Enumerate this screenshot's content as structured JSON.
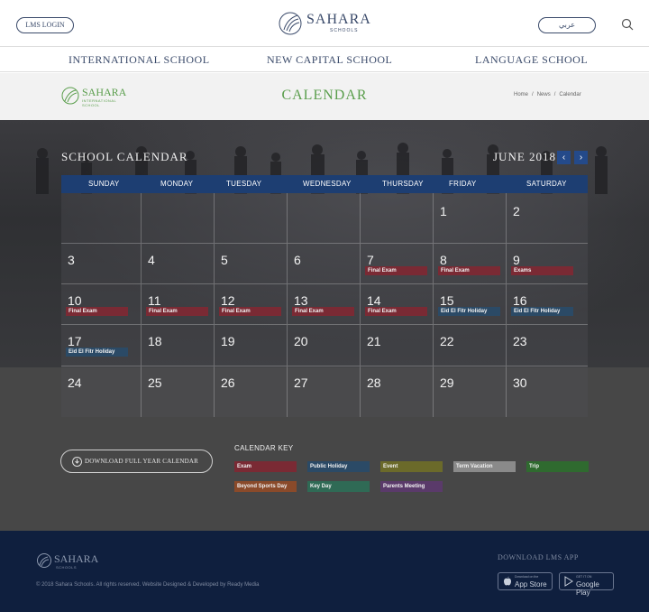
{
  "header": {
    "lms_login": "LMS LOGIN",
    "arabic_label": "عربي",
    "logo_word": "SAHARA",
    "logo_sub": "SCHOOLS"
  },
  "nav": {
    "items": [
      "INTERNATIONAL SCHOOL",
      "NEW CAPITAL SCHOOL",
      "LANGUAGE SCHOOL"
    ]
  },
  "title_band": {
    "title": "CALENDAR",
    "small_logo_word": "SAHARA",
    "small_logo_sub": "INTERNATIONAL SCHOOL",
    "breadcrumb": [
      "Home",
      "News",
      "Calendar"
    ],
    "separator": "/"
  },
  "calendar": {
    "heading": "SCHOOL CALENDAR",
    "month": "JUNE 2018",
    "prev_icon": "chevron-left-icon",
    "next_icon": "chevron-right-icon",
    "weekdays": [
      "SUNDAY",
      "MONDAY",
      "TUESDAY",
      "WEDNESDAY",
      "THURSDAY",
      "FRIDAY",
      "SATURDAY"
    ],
    "weeks": [
      [
        {
          "d": ""
        },
        {
          "d": ""
        },
        {
          "d": ""
        },
        {
          "d": ""
        },
        {
          "d": ""
        },
        {
          "d": "1"
        },
        {
          "d": "2"
        }
      ],
      [
        {
          "d": "3"
        },
        {
          "d": "4"
        },
        {
          "d": "5"
        },
        {
          "d": "6"
        },
        {
          "d": "7",
          "ev": "Final Exam",
          "t": "exam"
        },
        {
          "d": "8",
          "ev": "Final Exam",
          "t": "exam"
        },
        {
          "d": "9",
          "ev": "Exams",
          "t": "exam"
        }
      ],
      [
        {
          "d": "10",
          "ev": "Final Exam",
          "t": "exam"
        },
        {
          "d": "11",
          "ev": "Final Exam",
          "t": "exam"
        },
        {
          "d": "12",
          "ev": "Final Exam",
          "t": "exam"
        },
        {
          "d": "13",
          "ev": "Final Exam",
          "t": "exam"
        },
        {
          "d": "14",
          "ev": "Final Exam",
          "t": "exam"
        },
        {
          "d": "15",
          "ev": "Eid El Fitr Holiday",
          "t": "hol"
        },
        {
          "d": "16",
          "ev": "Eid El Fitr Holiday",
          "t": "hol"
        }
      ],
      [
        {
          "d": "17",
          "ev": "Eid El Fitr Holiday",
          "t": "hol"
        },
        {
          "d": "18"
        },
        {
          "d": "19"
        },
        {
          "d": "20"
        },
        {
          "d": "21"
        },
        {
          "d": "22"
        },
        {
          "d": "23"
        }
      ],
      [
        {
          "d": "24"
        },
        {
          "d": "25"
        },
        {
          "d": "26"
        },
        {
          "d": "27"
        },
        {
          "d": "28"
        },
        {
          "d": "29"
        },
        {
          "d": "30"
        }
      ]
    ]
  },
  "download": {
    "label": "DOWNLOAD FULL YEAR CALENDAR",
    "icon": "download-icon"
  },
  "key": {
    "heading": "CALENDAR KEY",
    "items": [
      {
        "label": "Exam",
        "color": "#7a2a34"
      },
      {
        "label": "Public Holiday",
        "color": "#2b4a66"
      },
      {
        "label": "Event",
        "color": "#6b6a2a"
      },
      {
        "label": "Term Vacation",
        "color": "#8a8a8a"
      },
      {
        "label": "Trip",
        "color": "#2f6a2f"
      },
      {
        "label": "Beyond Sports Day",
        "color": "#8a4a2a"
      },
      {
        "label": "Key Day",
        "color": "#2f6a55"
      },
      {
        "label": "Parents Meeting",
        "color": "#5a3a6a"
      }
    ]
  },
  "footer": {
    "logo_word": "SAHARA",
    "logo_sub": "SCHOOLS",
    "copyright": "© 2018 Sahara Schools. All rights reserved. Website Designed & Developed by Ready Media",
    "download_app": "DOWNLOAD LMS APP",
    "app_store_small": "Download on the",
    "app_store_big": "App Store",
    "google_small": "GET IT ON",
    "google_big": "Google Play"
  }
}
